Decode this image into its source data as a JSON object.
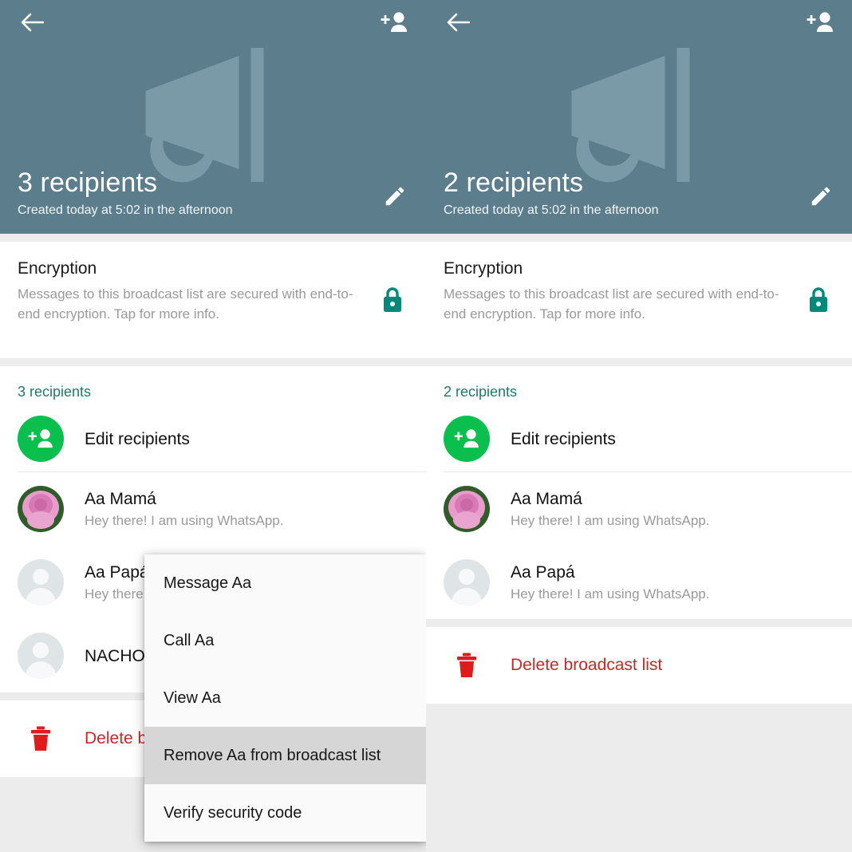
{
  "panels": [
    {
      "id": "left",
      "header": {
        "back_icon": "back-arrow-icon",
        "add_person_icon": "add-person-icon",
        "megaphone_icon": "megaphone-icon",
        "edit_icon": "pencil-edit-icon",
        "title": "3 recipients",
        "subtitle": "Created today at 5:02 in the afternoon"
      },
      "encryption": {
        "title": "Encryption",
        "description": "Messages to this broadcast list are secured with end-to-end encryption. Tap for more info.",
        "lock_icon": "lock-icon"
      },
      "recipients": {
        "section_label": "3 recipients",
        "edit_label": "Edit recipients",
        "edit_icon": "add-person-circle-icon",
        "contacts": [
          {
            "name": "Aa Mamá",
            "status": "Hey there! I am using WhatsApp.",
            "avatar": "rose-photo"
          },
          {
            "name": "Aa Papá",
            "status": "Hey there! I am using WhatsApp.",
            "avatar": "default-person"
          },
          {
            "name": "NACHO",
            "status": "",
            "avatar": "default-person"
          }
        ]
      },
      "delete": {
        "label": "Delete broadcast list",
        "icon": "trash-icon"
      }
    },
    {
      "id": "right",
      "header": {
        "back_icon": "back-arrow-icon",
        "add_person_icon": "add-person-icon",
        "megaphone_icon": "megaphone-icon",
        "edit_icon": "pencil-edit-icon",
        "title": "2 recipients",
        "subtitle": "Created today at 5:02 in the afternoon"
      },
      "encryption": {
        "title": "Encryption",
        "description": "Messages to this broadcast list are secured with end-to-end encryption. Tap for more info.",
        "lock_icon": "lock-icon"
      },
      "recipients": {
        "section_label": "2 recipients",
        "edit_label": "Edit recipients",
        "edit_icon": "add-person-circle-icon",
        "contacts": [
          {
            "name": "Aa Mamá",
            "status": "Hey there! I am using WhatsApp.",
            "avatar": "rose-photo"
          },
          {
            "name": "Aa Papá",
            "status": "Hey there! I am using WhatsApp.",
            "avatar": "default-person"
          }
        ]
      },
      "delete": {
        "label": "Delete broadcast list",
        "icon": "trash-icon"
      }
    }
  ],
  "context_menu": {
    "items": [
      {
        "label": "Message Aa",
        "highlighted": false
      },
      {
        "label": "Call Aa",
        "highlighted": false
      },
      {
        "label": "View Aa",
        "highlighted": false
      },
      {
        "label": "Remove Aa from broadcast list",
        "highlighted": true
      },
      {
        "label": "Verify security code",
        "highlighted": false
      }
    ]
  },
  "colors": {
    "header_bg": "#5c7d8c",
    "megaphone": "#7b9aa8",
    "accent_green": "#0bbf4e",
    "section_green": "#1f7a66",
    "lock_teal": "#00897b",
    "danger_red": "#c62828",
    "page_bg": "#ececec",
    "card_bg": "#ffffff",
    "menu_bg": "#fafafa",
    "menu_highlight": "#d6d6d6"
  }
}
